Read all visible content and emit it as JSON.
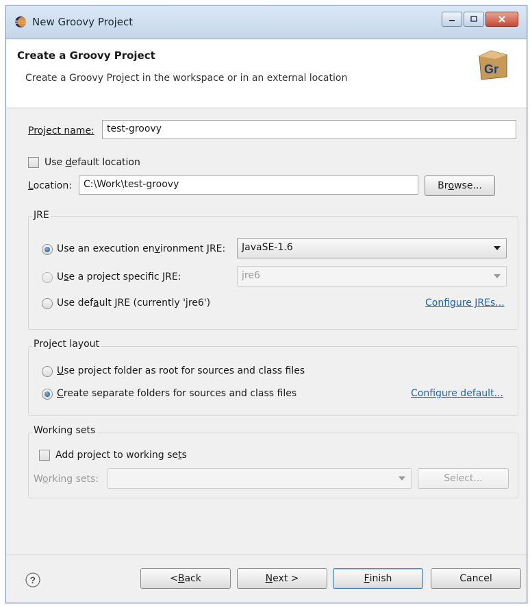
{
  "window": {
    "title": "New Groovy Project"
  },
  "header": {
    "title": "Create a Groovy Project",
    "description": "Create a Groovy Project in the workspace or in an external location",
    "logo_text": "Gr"
  },
  "project_name": {
    "label": "Project name:",
    "value": "test-groovy"
  },
  "default_location": {
    "label_pre": "Use ",
    "label_mn": "d",
    "label_post": "efault location",
    "checked": false
  },
  "location": {
    "label_pre": "",
    "label_mn": "L",
    "label_post": "ocation:",
    "value": "C:\\Work\\test-groovy",
    "browse_pre": "Br",
    "browse_mn": "o",
    "browse_post": "wse..."
  },
  "jre": {
    "group_title": "JRE",
    "opt_exec_pre": "Use an execution en",
    "opt_exec_mn": "v",
    "opt_exec_post": "ironment JRE:",
    "opt_exec_value": "JavaSE-1.6",
    "opt_specific_pre": "U",
    "opt_specific_mn": "s",
    "opt_specific_post": "e a project specific JRE:",
    "opt_specific_value": "jre6",
    "opt_default_pre": "Use def",
    "opt_default_mn": "a",
    "opt_default_post": "ult JRE (currently 'jre6')",
    "configure_link": "Configure JREs..."
  },
  "layout": {
    "group_title": "Project layout",
    "opt_root_pre": "",
    "opt_root_mn": "U",
    "opt_root_post": "se project folder as root for sources and class files",
    "opt_separate_pre": "",
    "opt_separate_mn": "C",
    "opt_separate_post": "reate separate folders for sources and class files",
    "configure_link": "Configure default..."
  },
  "working_sets": {
    "group_title": "Working sets",
    "add_pre": "Add project to working se",
    "add_mn": "t",
    "add_post": "s",
    "sets_pre": "W",
    "sets_mn": "o",
    "sets_post": "rking sets:",
    "select_label": "Select..."
  },
  "footer": {
    "back_pre": "< ",
    "back_mn": "B",
    "back_post": "ack",
    "next_pre": "",
    "next_mn": "N",
    "next_post": "ext >",
    "finish_pre": "",
    "finish_mn": "F",
    "finish_post": "inish",
    "cancel_label": "Cancel"
  },
  "colors": {
    "link": "#1b64b4",
    "titlebar": "#c5d6ea",
    "default_button_border": "#3c7fb1"
  },
  "icons": [
    "eclipse-icon",
    "minimize-icon",
    "maximize-icon",
    "close-icon",
    "groovy-logo",
    "help-icon",
    "chevron-down-icon"
  ]
}
